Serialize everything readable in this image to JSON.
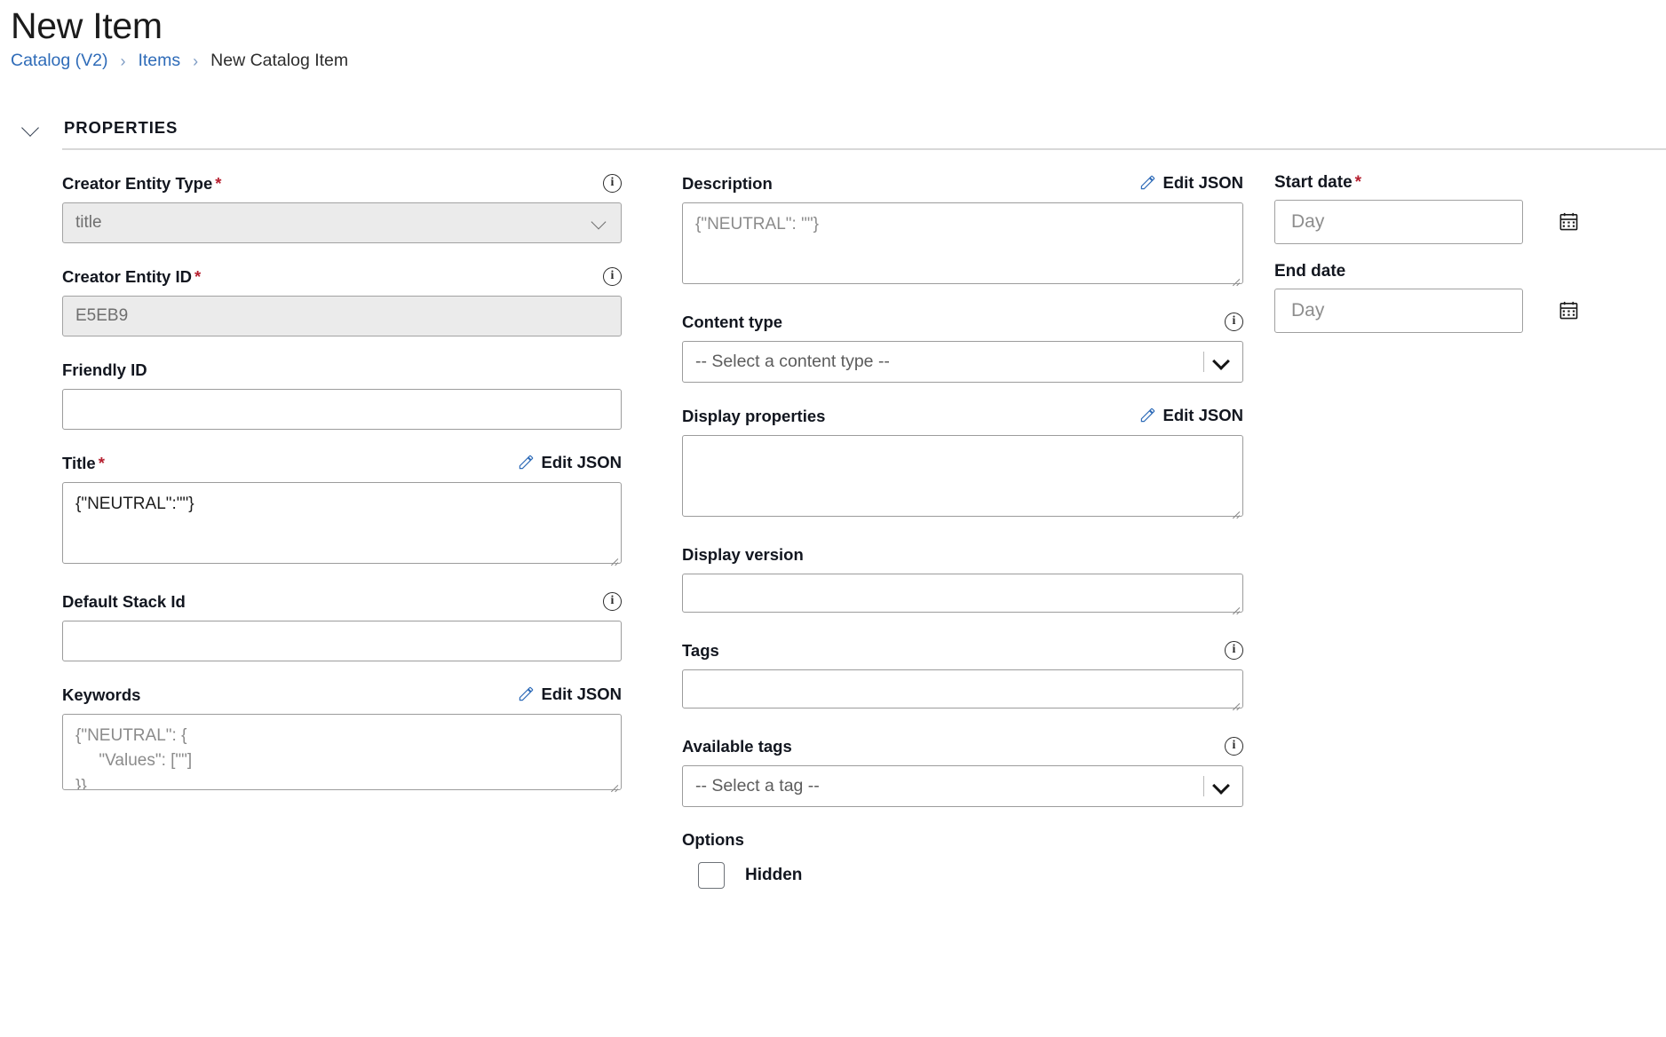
{
  "header": {
    "title": "New Item",
    "breadcrumb": [
      {
        "label": "Catalog (V2)",
        "link": true
      },
      {
        "label": "Items",
        "link": true
      },
      {
        "label": "New Catalog Item",
        "link": false
      }
    ],
    "separator": "›"
  },
  "section": {
    "title": "PROPERTIES",
    "collapse_icon": "chevron-down-icon"
  },
  "icons": {
    "info": "i",
    "edit_json_label": "Edit JSON",
    "pencil": "pencil-icon",
    "calendar": "calendar-icon"
  },
  "left_column": {
    "creator_entity_type": {
      "label": "Creator Entity Type",
      "required": true,
      "has_info": true,
      "value": "title",
      "disabled": true
    },
    "creator_entity_id": {
      "label": "Creator Entity ID",
      "required": true,
      "has_info": true,
      "value": "E5EB9",
      "disabled": true
    },
    "friendly_id": {
      "label": "Friendly ID",
      "required": false,
      "has_info": false,
      "value": "",
      "placeholder": ""
    },
    "title": {
      "label": "Title",
      "required": true,
      "edit_json": "Edit JSON",
      "value": "{\"NEUTRAL\":\"\"}"
    },
    "default_stack_id": {
      "label": "Default Stack Id",
      "required": false,
      "has_info": true,
      "value": "",
      "placeholder": ""
    },
    "keywords": {
      "label": "Keywords",
      "required": false,
      "edit_json": "Edit JSON",
      "value": "",
      "placeholder": "{\"NEUTRAL\": {\n     \"Values\": [\"\"]\n}}"
    }
  },
  "middle_column": {
    "description": {
      "label": "Description",
      "edit_json": "Edit JSON",
      "value": "",
      "placeholder": "{\"NEUTRAL\": \"\"}"
    },
    "content_type": {
      "label": "Content type",
      "has_info": true,
      "selected": "-- Select a content type --"
    },
    "display_properties": {
      "label": "Display properties",
      "edit_json": "Edit JSON",
      "value": "",
      "placeholder": ""
    },
    "display_version": {
      "label": "Display version",
      "value": "",
      "placeholder": ""
    },
    "tags": {
      "label": "Tags",
      "has_info": true,
      "value": "",
      "placeholder": ""
    },
    "available_tags": {
      "label": "Available tags",
      "has_info": true,
      "selected": "-- Select a tag --"
    },
    "options": {
      "label": "Options",
      "hidden_checkbox": {
        "label": "Hidden",
        "checked": false
      }
    }
  },
  "right_column": {
    "start_date": {
      "label": "Start date",
      "required": true,
      "value": "",
      "placeholder": "Day"
    },
    "end_date": {
      "label": "End date",
      "required": false,
      "value": "",
      "placeholder": "Day"
    }
  },
  "colors": {
    "link": "#2e6bb8",
    "required_asterisk": "#b62030",
    "text": "#16181d",
    "border": "#9c9c9c",
    "disabled_bg": "#ebebeb",
    "rule": "#d8d8d8"
  }
}
